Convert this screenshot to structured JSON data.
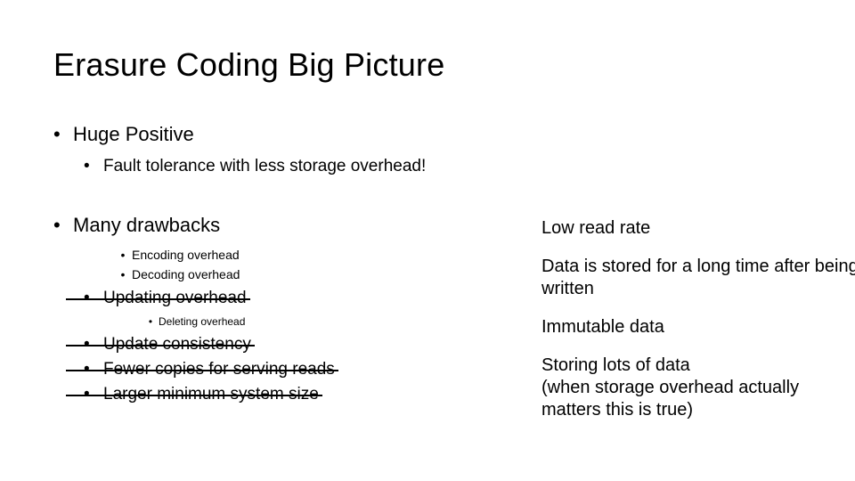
{
  "title": "Erasure Coding Big Picture",
  "left": {
    "positive_heading": "Huge Positive",
    "positive_sub": "Fault tolerance with less storage overhead!",
    "drawbacks_heading": "Many drawbacks",
    "items": {
      "encoding": "Encoding overhead",
      "decoding": "Decoding overhead",
      "updating": "Updating overhead",
      "deleting": "Deleting overhead",
      "consistency": "Update consistency",
      "fewer_copies": "Fewer copies for serving reads",
      "larger_min": "Larger minimum system size"
    }
  },
  "notes": {
    "n1": "Low read rate",
    "n2": "Data is stored for a long time after being written",
    "n3": "Immutable data",
    "n4a": "Storing lots of data",
    "n4b": "(when storage overhead actually matters this is true)"
  },
  "glyphs": {
    "dot": "•"
  }
}
